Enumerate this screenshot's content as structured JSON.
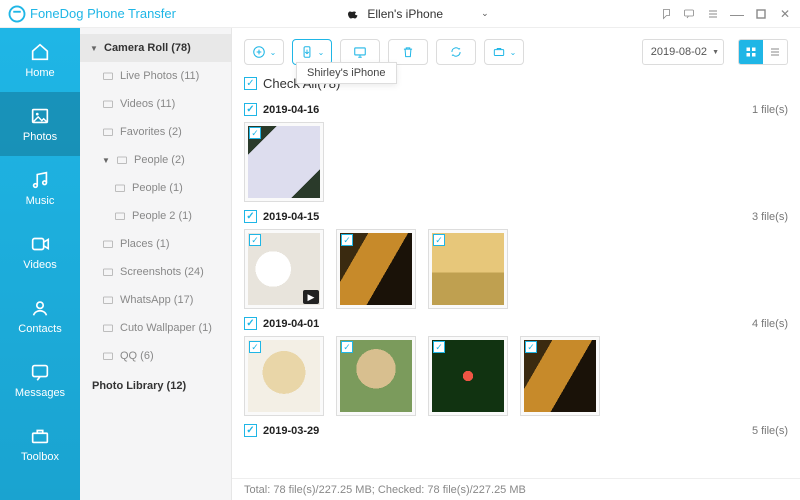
{
  "app_title": "FoneDog Phone Transfer",
  "device": {
    "name": "Ellen's iPhone"
  },
  "tooltip": "Shirley's iPhone",
  "rail": [
    {
      "id": "home",
      "label": "Home"
    },
    {
      "id": "photos",
      "label": "Photos"
    },
    {
      "id": "music",
      "label": "Music"
    },
    {
      "id": "videos",
      "label": "Videos"
    },
    {
      "id": "contacts",
      "label": "Contacts"
    },
    {
      "id": "messages",
      "label": "Messages"
    },
    {
      "id": "toolbox",
      "label": "Toolbox"
    }
  ],
  "tree": {
    "root": {
      "label": "Camera Roll",
      "count": 78
    },
    "items": [
      {
        "id": "live",
        "label": "Live Photos",
        "count": 11
      },
      {
        "id": "videos",
        "label": "Videos",
        "count": 11
      },
      {
        "id": "favorites",
        "label": "Favorites",
        "count": 2
      },
      {
        "id": "people",
        "label": "People",
        "count": 2,
        "expandable": true
      },
      {
        "id": "people1",
        "label": "People",
        "count": 1,
        "depth": 2
      },
      {
        "id": "people2",
        "label": "People 2",
        "count": 1,
        "depth": 2
      },
      {
        "id": "places",
        "label": "Places",
        "count": 1
      },
      {
        "id": "screenshots",
        "label": "Screenshots",
        "count": 24
      },
      {
        "id": "whatsapp",
        "label": "WhatsApp",
        "count": 17
      },
      {
        "id": "cuto",
        "label": "Cuto Wallpaper",
        "count": 1
      },
      {
        "id": "qq",
        "label": "QQ",
        "count": 6
      }
    ],
    "library": {
      "label": "Photo Library",
      "count": 12
    }
  },
  "toolbar": {
    "date": "2019-08-02"
  },
  "checkall": {
    "label": "Check All",
    "count": 78
  },
  "groups": [
    {
      "date": "2019-04-16",
      "file_label": "1 file(s)",
      "thumbs": [
        {
          "cls": "ph-phone"
        }
      ]
    },
    {
      "date": "2019-04-15",
      "file_label": "3 file(s)",
      "thumbs": [
        {
          "cls": "ph-mug",
          "video": true
        },
        {
          "cls": "ph-drink"
        },
        {
          "cls": "ph-salt"
        }
      ]
    },
    {
      "date": "2019-04-01",
      "file_label": "4 file(s)",
      "thumbs": [
        {
          "cls": "ph-pup1"
        },
        {
          "cls": "ph-pup2"
        },
        {
          "cls": "ph-lights"
        },
        {
          "cls": "ph-drink"
        }
      ]
    },
    {
      "date": "2019-03-29",
      "file_label": "5 file(s)",
      "thumbs": []
    }
  ],
  "footer": {
    "total_files": 78,
    "total_size": "227.25 MB",
    "checked_files": 78,
    "checked_size": "227.25 MB"
  }
}
